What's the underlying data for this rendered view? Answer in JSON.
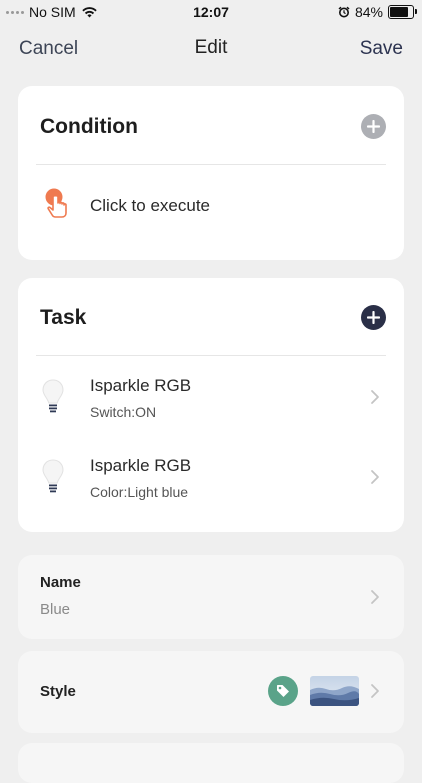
{
  "status_bar": {
    "carrier": "No SIM",
    "time": "12:07",
    "battery_percent": "84%",
    "battery_level": 0.84
  },
  "nav": {
    "cancel": "Cancel",
    "title": "Edit",
    "save": "Save"
  },
  "condition": {
    "title": "Condition",
    "items": [
      {
        "label": "Click to execute",
        "icon": "hand-tap-icon",
        "icon_color": "#ef7a50"
      }
    ]
  },
  "task": {
    "title": "Task",
    "items": [
      {
        "name": "Isparkle RGB",
        "detail": "Switch:ON",
        "icon": "light-bulb-icon"
      },
      {
        "name": "Isparkle RGB",
        "detail": "Color:Light blue",
        "icon": "light-bulb-icon"
      }
    ]
  },
  "name_field": {
    "label": "Name",
    "value": "Blue"
  },
  "style_field": {
    "label": "Style",
    "tag_color": "#5aa389"
  },
  "colors": {
    "accent_dark": "#2a2f47",
    "background": "#efefef",
    "card": "#ffffff"
  }
}
